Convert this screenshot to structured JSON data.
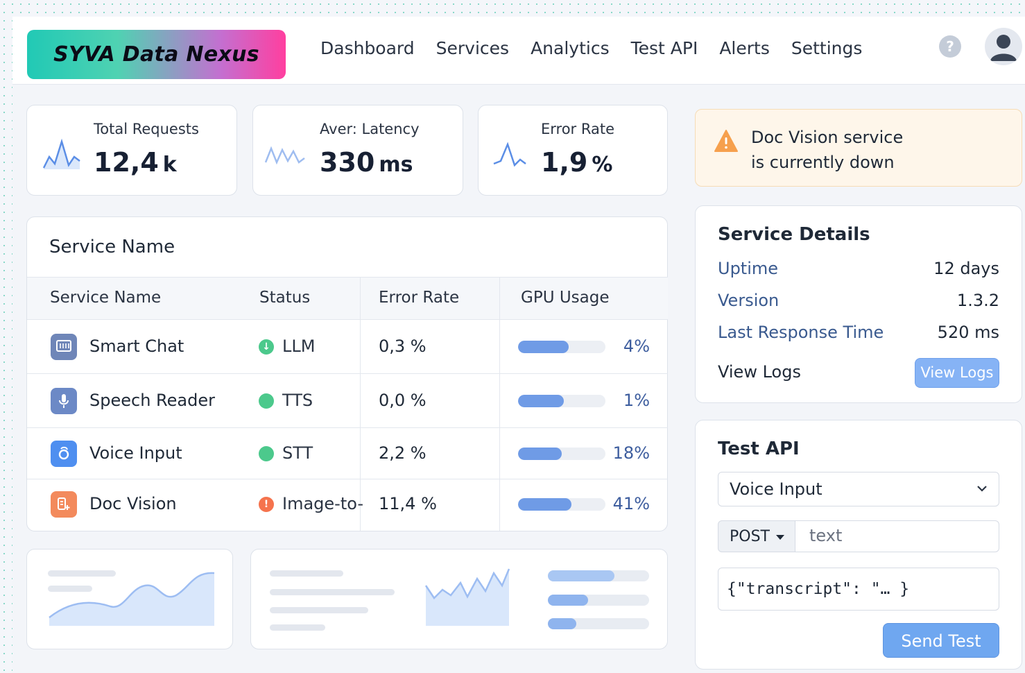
{
  "app": {
    "logo": "SYVA Data Nexus"
  },
  "nav": [
    "Dashboard",
    "Services",
    "Analytics",
    "Test API",
    "Alerts",
    "Settings"
  ],
  "header": {
    "help_glyph": "?"
  },
  "stats": [
    {
      "title": "Total Requests",
      "value": "12,4",
      "unit": "k"
    },
    {
      "title": "Aver: Latency",
      "value": "330",
      "unit": "ms"
    },
    {
      "title": "Error Rate",
      "value": "1,9",
      "unit": "%"
    }
  ],
  "table": {
    "title": "Service Name",
    "columns": [
      "Service Name",
      "Status",
      "Error Rate",
      "GPU Usage"
    ],
    "rows": [
      {
        "name": "Smart Chat",
        "status": "LLM",
        "status_ok": true,
        "error": "0,3 %",
        "gpu": "4%",
        "gpu_fill": 0.58,
        "icon": "chat-icon",
        "icon_color": "#6f86b8"
      },
      {
        "name": "Speech Reader",
        "status": "TTS",
        "status_ok": true,
        "error": "0,0 %",
        "gpu": "1%",
        "gpu_fill": 0.52,
        "icon": "microphone-icon",
        "icon_color": "#6c89c6"
      },
      {
        "name": "Voice Input",
        "status": "STT",
        "status_ok": true,
        "error": "2,2 %",
        "gpu": "18%",
        "gpu_fill": 0.5,
        "icon": "voice-icon",
        "icon_color": "#4f8ff0"
      },
      {
        "name": "Doc Vision",
        "status": "Image-to-",
        "status_ok": false,
        "error": "11,4 %",
        "gpu": "41%",
        "gpu_fill": 0.61,
        "icon": "document-icon",
        "icon_color": "#f38a5c"
      }
    ]
  },
  "alert": {
    "line1": "Doc Vision service",
    "line2": "is currently down",
    "icon": "warning-icon"
  },
  "details": {
    "title": "Service Details",
    "items": [
      {
        "label": "Uptime",
        "value": "12 days"
      },
      {
        "label": "Version",
        "value": "1.3.2"
      },
      {
        "label": "Last Response Time",
        "value": "520 ms"
      }
    ],
    "logs_label": "View Logs",
    "logs_button": "View Logs"
  },
  "test_api": {
    "title": "Test API",
    "service": "Voice Input",
    "method": "POST",
    "path": "text",
    "body": "{\"transcript\": \"… }",
    "send_button": "Send Test"
  },
  "colors": {
    "accent": "#6fa7f0",
    "ok": "#4cc98c",
    "error": "#f5734d",
    "bar": "#6f9be6"
  }
}
